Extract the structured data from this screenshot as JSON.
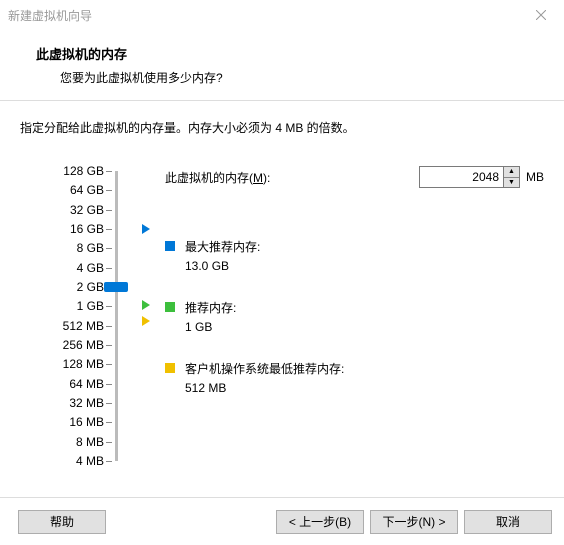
{
  "window": {
    "title": "新建虚拟机向导"
  },
  "header": {
    "title": "此虚拟机的内存",
    "subtitle": "您要为此虚拟机使用多少内存?"
  },
  "instruction": "指定分配给此虚拟机的内存量。内存大小必须为 4 MB 的倍数。",
  "memory": {
    "label_prefix": "此虚拟机的内存(",
    "label_accel": "M",
    "label_suffix": "):",
    "value": "2048",
    "unit": "MB"
  },
  "ticks": [
    "128 GB",
    "64 GB",
    "32 GB",
    "16 GB",
    "8 GB",
    "4 GB",
    "2 GB",
    "1 GB",
    "512 MB",
    "256 MB",
    "128 MB",
    "64 MB",
    "32 MB",
    "16 MB",
    "8 MB",
    "4 MB"
  ],
  "legend": {
    "max": {
      "label": "最大推荐内存:",
      "value": "13.0 GB"
    },
    "rec": {
      "label": "推荐内存:",
      "value": "1 GB"
    },
    "min": {
      "label": "客户机操作系统最低推荐内存:",
      "value": "512 MB"
    }
  },
  "footer": {
    "help": "帮助",
    "back": "< 上一步(B)",
    "next": "下一步(N) >",
    "cancel": "取消"
  }
}
